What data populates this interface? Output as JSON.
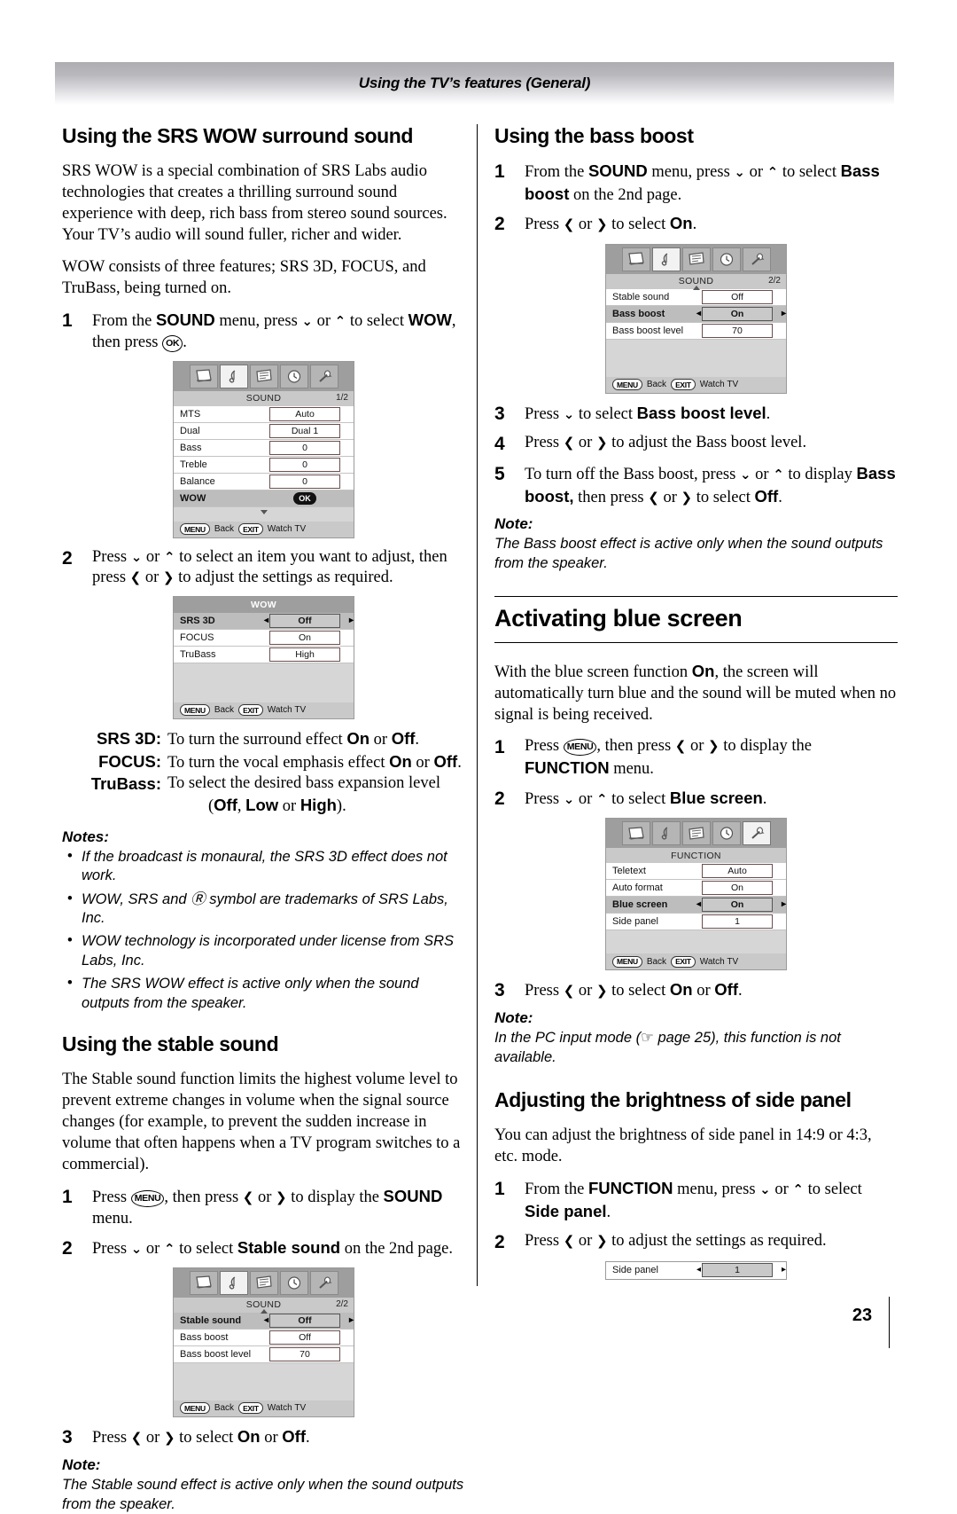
{
  "header": {
    "title": "Using the TV’s features (General)"
  },
  "page_number": "23",
  "left": {
    "srs": {
      "heading": "Using the SRS WOW surround sound",
      "para1": "SRS WOW is a special combination of SRS Labs audio technologies that creates a thrilling surround sound experience with deep, rich bass from stereo sound sources. Your TV’s audio will sound fuller, richer and wider.",
      "para2": "WOW consists of three features; SRS 3D, FOCUS, and TruBass, being turned on.",
      "step1_num": "1",
      "step1_a": "From the ",
      "step1_sound": "SOUND",
      "step1_b": " menu, press ",
      "step1_c": " or ",
      "step1_d": " to select ",
      "step1_wow": "WOW",
      "step1_e": ", then press ",
      "step1_ok": "OK",
      "step1_f": ".",
      "step2_num": "2",
      "step2_a": "Press ",
      "step2_b": " or ",
      "step2_c": " to select an item you want to adjust, then press ",
      "step2_d": " or ",
      "step2_e": " to adjust the settings as required."
    },
    "menu_sound_1": {
      "title": "SOUND",
      "page": "1/2",
      "rows": [
        {
          "label": "MTS",
          "value": "Auto",
          "selected": false
        },
        {
          "label": "Dual",
          "value": "Dual 1",
          "selected": false
        },
        {
          "label": "Bass",
          "value": "0",
          "selected": false
        },
        {
          "label": "Treble",
          "value": "0",
          "selected": false
        },
        {
          "label": "Balance",
          "value": "0",
          "selected": false
        }
      ],
      "wow_label": "WOW",
      "wow_ok": "OK",
      "footer_menu": "MENU",
      "footer_back": "Back",
      "footer_exit": "EXIT",
      "footer_watch": "Watch TV"
    },
    "menu_wow": {
      "title": "WOW",
      "rows": [
        {
          "label": "SRS 3D",
          "value": "Off",
          "selected": true
        },
        {
          "label": "FOCUS",
          "value": "On",
          "selected": false
        },
        {
          "label": "TruBass",
          "value": "High",
          "selected": false
        }
      ],
      "footer_menu": "MENU",
      "footer_back": "Back",
      "footer_exit": "EXIT",
      "footer_watch": "Watch TV"
    },
    "defs": [
      {
        "term": "SRS 3D",
        "colon": ":",
        "desc_a": "To turn the surround effect ",
        "on": "On",
        "or": " or ",
        "off": "Off",
        "tail": "."
      },
      {
        "term": "FOCUS",
        "colon": ":",
        "desc_a": "To turn the vocal emphasis effect ",
        "on": "On",
        "or": " or ",
        "off": "Off",
        "tail": "."
      },
      {
        "term": "TruBass",
        "colon": ":",
        "desc_a": "To select the desired bass expansion level",
        "on": "",
        "or": "",
        "off": "",
        "tail": ""
      }
    ],
    "defs_sub_a": "(",
    "defs_sub_off": "Off",
    "defs_sub_b": ", ",
    "defs_sub_low": "Low",
    "defs_sub_c": " or ",
    "defs_sub_high": "High",
    "defs_sub_d": ").",
    "notes_title": "Notes:",
    "notes": [
      "If the broadcast is monaural, the SRS 3D effect does not work.",
      "WOW, SRS and Ⓡ symbol are trademarks of SRS Labs, Inc.",
      "WOW technology is incorporated under license from SRS Labs, Inc.",
      "The SRS WOW effect is active only when the sound outputs from the speaker."
    ],
    "stable": {
      "heading": "Using the stable sound",
      "para": "The Stable sound function limits the highest volume level to prevent extreme changes in volume when the signal source changes (for example, to prevent the sudden increase in volume that often happens when a TV program switches to a commercial).",
      "step1_num": "1",
      "step1_a": "Press ",
      "step1_key": "MENU",
      "step1_b": ", then press ",
      "step1_c": " or ",
      "step1_d": " to display the ",
      "step1_sound": "SOUND",
      "step1_e": " menu.",
      "step2_num": "2",
      "step2_a": "Press ",
      "step2_b": " or ",
      "step2_c": " to select ",
      "step2_bold": "Stable sound",
      "step2_d": " on the 2nd page.",
      "step3_num": "3",
      "step3_a": "Press ",
      "step3_b": " or ",
      "step3_c": " to select ",
      "step3_on": "On",
      "step3_d": " or ",
      "step3_off": "Off",
      "step3_e": "."
    },
    "menu_sound_2": {
      "title": "SOUND",
      "page": "2/2",
      "rows": [
        {
          "label": "Stable sound",
          "value": "Off",
          "selected": true
        },
        {
          "label": "Bass boost",
          "value": "Off",
          "selected": false
        },
        {
          "label": "Bass boost level",
          "value": "70",
          "selected": false
        }
      ],
      "footer_menu": "MENU",
      "footer_back": "Back",
      "footer_exit": "EXIT",
      "footer_watch": "Watch TV"
    },
    "note_title": "Note:",
    "note_text": "The Stable sound effect is active only when the sound outputs from the speaker."
  },
  "right": {
    "bass": {
      "heading": "Using the bass boost",
      "step1_num": "1",
      "step1_a": "From the ",
      "step1_sound": "SOUND",
      "step1_b": " menu, press ",
      "step1_c": " or ",
      "step1_d": " to select ",
      "step1_bold": "Bass boost",
      "step1_e": " on the 2nd page.",
      "step2_num": "2",
      "step2_a": "Press ",
      "step2_b": " or ",
      "step2_c": " to select ",
      "step2_on": "On",
      "step2_d": ".",
      "step3_num": "3",
      "step3_a": "Press ",
      "step3_b": " to select ",
      "step3_bold": "Bass boost level",
      "step3_c": ".",
      "step4_num": "4",
      "step4_a": "Press ",
      "step4_b": " or ",
      "step4_c": " to adjust the Bass boost level.",
      "step5_num": "5",
      "step5_a": "To turn off the Bass boost, press ",
      "step5_b": " or ",
      "step5_c": " to display ",
      "step5_bold": "Bass boost,",
      "step5_d": " then press ",
      "step5_e": " or ",
      "step5_f": " to select ",
      "step5_off": "Off",
      "step5_g": ".",
      "note_title": "Note:",
      "note_text": "The Bass boost effect is active only when the sound outputs from the speaker."
    },
    "menu_sound_bass": {
      "title": "SOUND",
      "page": "2/2",
      "rows": [
        {
          "label": "Stable sound",
          "value": "Off",
          "selected": false
        },
        {
          "label": "Bass boost",
          "value": "On",
          "selected": true
        },
        {
          "label": "Bass boost level",
          "value": "70",
          "selected": false
        }
      ],
      "footer_menu": "MENU",
      "footer_back": "Back",
      "footer_exit": "EXIT",
      "footer_watch": "Watch TV"
    },
    "blue": {
      "heading": "Activating blue screen",
      "para_a": "With the blue screen function ",
      "para_on": "On",
      "para_b": ", the screen will automatically turn blue and the sound will be muted when no signal is being received.",
      "step1_num": "1",
      "step1_a": "Press ",
      "step1_key": "MENU",
      "step1_b": ", then press ",
      "step1_c": " or ",
      "step1_d": " to display the ",
      "step1_func": "FUNCTION",
      "step1_e": " menu.",
      "step2_num": "2",
      "step2_a": "Press ",
      "step2_b": " or ",
      "step2_c": " to select ",
      "step2_bold": "Blue screen",
      "step2_d": ".",
      "step3_num": "3",
      "step3_a": "Press ",
      "step3_b": " or ",
      "step3_c": " to select ",
      "step3_on": "On",
      "step3_d": " or ",
      "step3_off": "Off",
      "step3_e": ".",
      "note_title": "Note:",
      "note_text_a": "In the PC input mode (",
      "note_hand": "☞",
      "note_text_b": " page 25), this function is not available."
    },
    "menu_function": {
      "title": "FUNCTION",
      "page": "",
      "rows": [
        {
          "label": "Teletext",
          "value": "Auto",
          "selected": false
        },
        {
          "label": "Auto format",
          "value": "On",
          "selected": false
        },
        {
          "label": "Blue screen",
          "value": "On",
          "selected": true
        },
        {
          "label": "Side panel",
          "value": "1",
          "selected": false
        }
      ],
      "footer_menu": "MENU",
      "footer_back": "Back",
      "footer_exit": "EXIT",
      "footer_watch": "Watch TV"
    },
    "side": {
      "heading": "Adjusting the brightness of side panel",
      "para": "You can adjust the brightness of side panel in 14:9 or 4:3, etc. mode.",
      "step1_num": "1",
      "step1_a": "From the ",
      "step1_func": "FUNCTION",
      "step1_b": " menu, press ",
      "step1_c": " or ",
      "step1_d": " to select ",
      "step1_bold": "Side panel",
      "step1_e": ".",
      "step2_num": "2",
      "step2_a": "Press ",
      "step2_b": " or ",
      "step2_c": " to adjust the settings as required.",
      "bar_label": "Side panel",
      "bar_value": "1"
    }
  },
  "icons": {
    "picture": "picture-icon",
    "sound": "music-note-icon",
    "program": "program-list-icon",
    "timer": "clock-icon",
    "function": "wrench-icon",
    "arrow_down": "⌄",
    "arrow_up": "⌃",
    "arrow_left": "‹",
    "arrow_right": "›"
  },
  "colors": {
    "banner_top": "#adadb2",
    "osd_bg": "#d6d6d6",
    "osd_sel": "#bdbdbd"
  }
}
